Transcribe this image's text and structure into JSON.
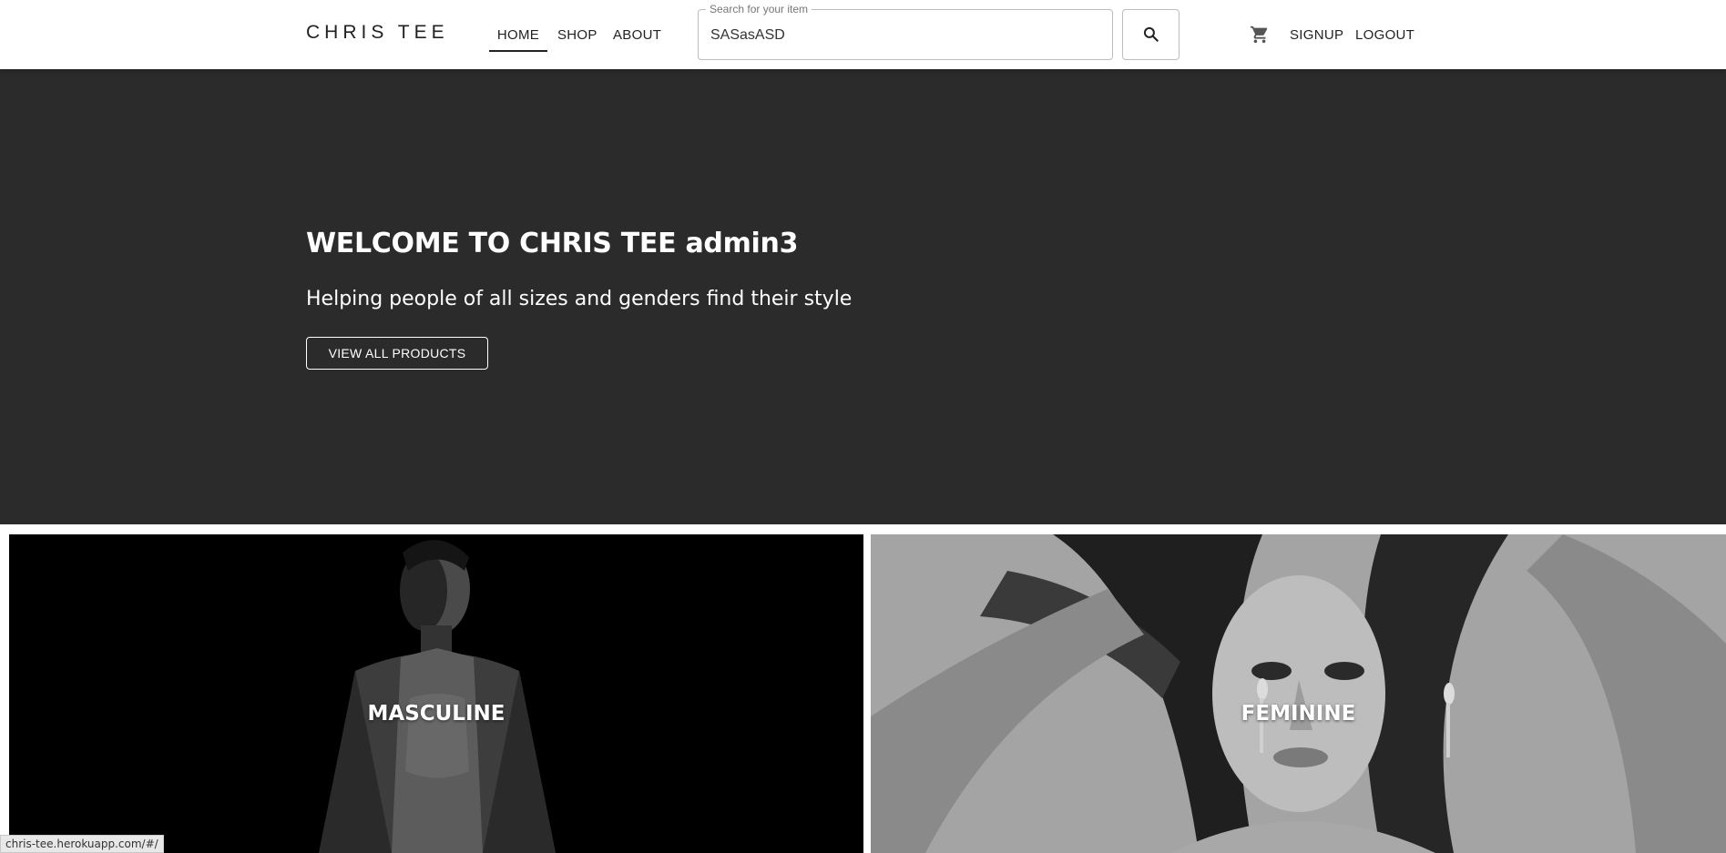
{
  "header": {
    "brand": "CHRIS TEE",
    "nav": {
      "home": "HOME",
      "shop": "SHOP",
      "about": "ABOUT",
      "signup": "SIGNUP",
      "logout": "LOGOUT"
    },
    "search": {
      "label": "Search for your item",
      "value": "SASasASD"
    },
    "icons": {
      "search": "search-icon",
      "cart": "shopping-cart-icon"
    }
  },
  "hero": {
    "title": "WELCOME TO CHRIS TEE admin3",
    "subtitle": "Helping people of all sizes and genders find their style",
    "button_label": "VIEW ALL PRODUCTS",
    "background_color": "#2b2b2b"
  },
  "categories": [
    {
      "label": "MASCULINE"
    },
    {
      "label": "FEMININE"
    }
  ],
  "status_bar": {
    "url": "chris-tee.herokuapp.com/#/"
  }
}
